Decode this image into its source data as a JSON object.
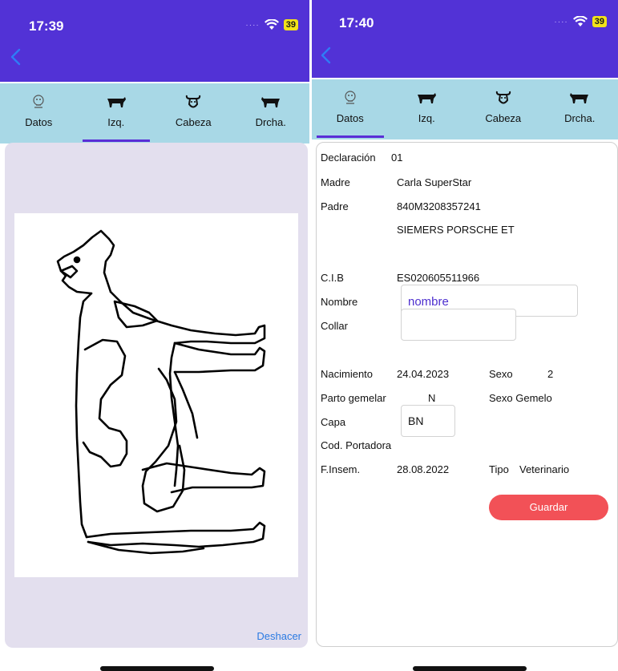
{
  "left": {
    "status": {
      "time": "17:39",
      "battery": "39"
    },
    "tabs": [
      {
        "label": "Datos",
        "icon": "cow-data-icon"
      },
      {
        "label": "Izq.",
        "icon": "cow-left-icon"
      },
      {
        "label": "Cabeza",
        "icon": "cow-head-icon"
      },
      {
        "label": "Drcha.",
        "icon": "cow-right-icon"
      }
    ],
    "active_tab": "Izq.",
    "undo_label": "Deshacer"
  },
  "right": {
    "status": {
      "time": "17:40",
      "battery": "39"
    },
    "tabs": [
      {
        "label": "Datos",
        "icon": "cow-data-icon"
      },
      {
        "label": "Izq.",
        "icon": "cow-left-icon"
      },
      {
        "label": "Cabeza",
        "icon": "cow-head-icon"
      },
      {
        "label": "Drcha.",
        "icon": "cow-right-icon"
      }
    ],
    "active_tab": "Datos",
    "form": {
      "declaracion_label": "Declaración",
      "declaracion_value": "01",
      "madre_label": "Madre",
      "madre_value": "Carla SuperStar",
      "padre_label": "Padre",
      "padre_value": "840M3208357241",
      "padre_name": "SIEMERS PORSCHE ET",
      "cib_label": "C.I.B",
      "cib_value": "ES020605511966",
      "nombre_label": "Nombre",
      "nombre_value": "nombre",
      "collar_label": "Collar",
      "collar_value": "",
      "nacimiento_label": "Nacimiento",
      "nacimiento_value": "24.04.2023",
      "sexo_label": "Sexo",
      "sexo_value": "2",
      "parto_label": "Parto gemelar",
      "parto_value": "N",
      "sexo_gemelo_label": "Sexo Gemelo",
      "capa_label": "Capa",
      "capa_value": "BN",
      "cod_portadora_label": "Cod. Portadora",
      "finsem_label": "F.Insem.",
      "finsem_value": "28.08.2022",
      "tipo_label": "Tipo",
      "tipo_value": "Veterinario"
    },
    "save_label": "Guardar"
  },
  "colors": {
    "header": "#5232d6",
    "tabs_bg": "#a8d8e6",
    "tab_indicator": "#5a2ed6",
    "canvas_bg": "#e3dfee",
    "save_button": "#f25157",
    "link": "#2a7ae2",
    "battery": "#f2e21a",
    "nombre_text": "#4d2fcf"
  }
}
